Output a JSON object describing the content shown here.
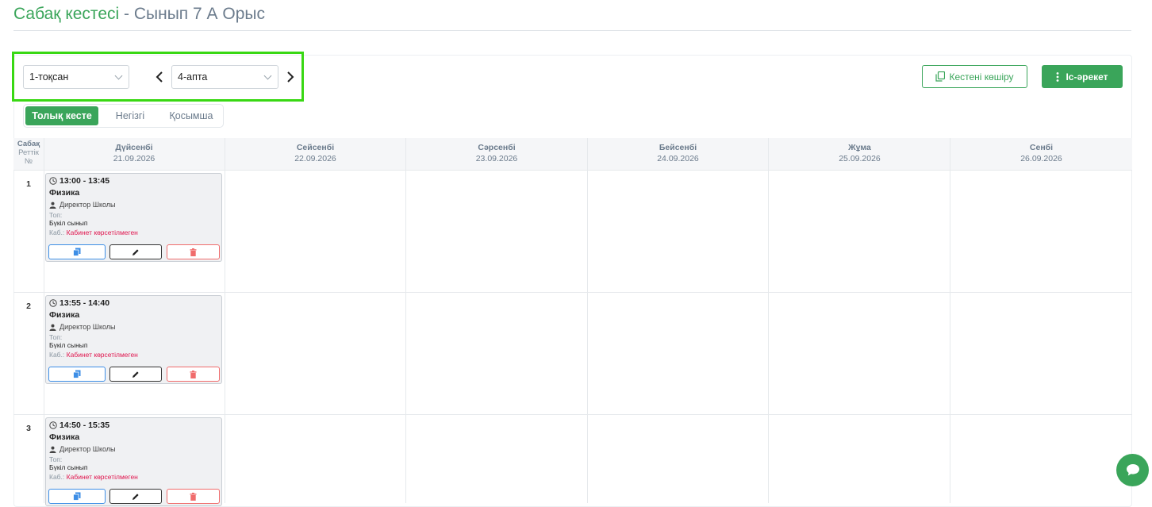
{
  "page": {
    "title_main": "Сабақ кестесі",
    "title_separator": " - ",
    "title_sub": "Сынып 7 А Орыс",
    "accent_color": "#3aa55a",
    "highlight_color": "#39d813"
  },
  "toolbar": {
    "quarter_select": "1-тоқсан",
    "week_select": "4-апта",
    "prev_icon": "chevron-left-icon",
    "next_icon": "chevron-right-icon",
    "copy_schedule_label": "Кестені көшіру",
    "actions_label": "Іс-әрекет"
  },
  "tabs": [
    {
      "label": "Толық кесте",
      "active": true
    },
    {
      "label": "Негізгі",
      "active": false
    },
    {
      "label": "Қосымша",
      "active": false
    }
  ],
  "grid": {
    "lesson_col": {
      "line1": "Сабақ",
      "line2": "Реттік",
      "line3": "№"
    },
    "days": [
      {
        "name": "Дүйсенбі",
        "date": "21.09.2026"
      },
      {
        "name": "Сейсенбі",
        "date": "22.09.2026"
      },
      {
        "name": "Сәрсенбі",
        "date": "23.09.2026"
      },
      {
        "name": "Бейсенбі",
        "date": "24.09.2026"
      },
      {
        "name": "Жұма",
        "date": "25.09.2026"
      },
      {
        "name": "Сенбі",
        "date": "26.09.2026"
      }
    ],
    "rows": [
      {
        "num": "1",
        "lesson": {
          "time": "13:00 - 13:45",
          "subject": "Физика",
          "teacher": "Директор Школы",
          "group_label": "Топ:",
          "group_value": "Бүкіл сынып",
          "room_label": "Каб.:",
          "room_value": "Кабинет көрсетілмеген"
        }
      },
      {
        "num": "2",
        "lesson": {
          "time": "13:55 - 14:40",
          "subject": "Физика",
          "teacher": "Директор Школы",
          "group_label": "Топ:",
          "group_value": "Бүкіл сынып",
          "room_label": "Каб.:",
          "room_value": "Кабинет көрсетілмеген"
        }
      },
      {
        "num": "3",
        "lesson": {
          "time": "14:50 - 15:35",
          "subject": "Физика",
          "teacher": "Директор Школы",
          "group_label": "Топ:",
          "group_value": "Бүкіл сынып",
          "room_label": "Каб.:",
          "room_value": "Кабинет көрсетілмеген"
        }
      }
    ]
  }
}
